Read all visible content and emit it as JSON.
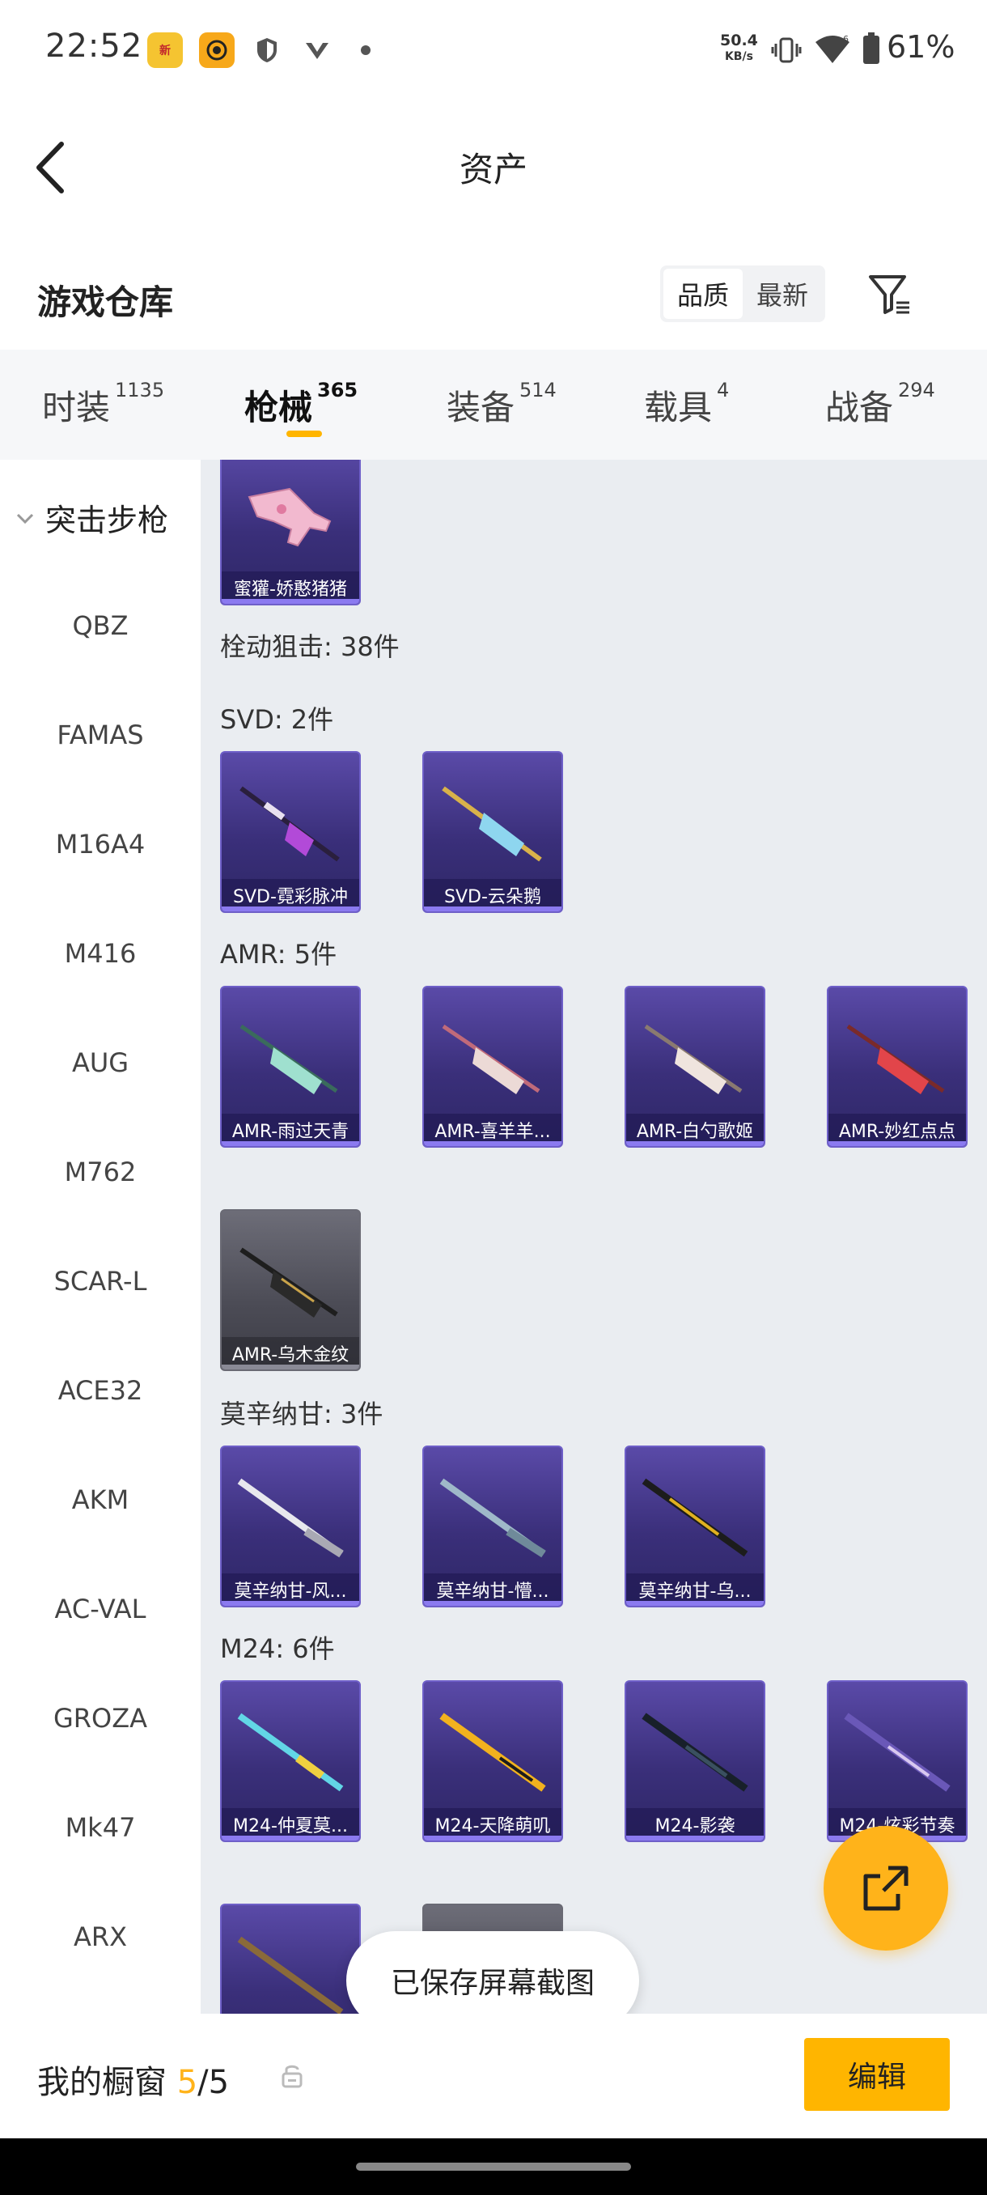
{
  "status_bar": {
    "time": "22:52",
    "net_speed_value": "50.4",
    "net_speed_unit": "KB/s",
    "battery": "61%",
    "app_icon_1_text": "新"
  },
  "header": {
    "title": "资产"
  },
  "section": {
    "title": "游戏仓库",
    "sort_options": [
      "品质",
      "最新"
    ]
  },
  "tabs": [
    {
      "label": "时装",
      "count": "1135"
    },
    {
      "label": "枪械",
      "count": "365"
    },
    {
      "label": "装备",
      "count": "514"
    },
    {
      "label": "载具",
      "count": "4"
    },
    {
      "label": "战备",
      "count": "294"
    }
  ],
  "sidebar": {
    "head": "突击步枪",
    "items": [
      "QBZ",
      "FAMAS",
      "M16A4",
      "M416",
      "AUG",
      "M762",
      "SCAR-L",
      "ACE32",
      "AKM",
      "AC-VAL",
      "GROZA",
      "Mk47",
      "ARX"
    ]
  },
  "content": {
    "top_card": "蜜獾-娇憨猪猪",
    "bolt_label": "栓动狙击: 38件",
    "groups": [
      {
        "label": "SVD: 2件",
        "items": [
          "SVD-霓彩脉冲",
          "SVD-云朵鹅"
        ]
      },
      {
        "label": "AMR: 5件",
        "items": [
          "AMR-雨过天青",
          "AMR-喜羊羊...",
          "AMR-白勺歌姬",
          "AMR-妙红点点",
          "AMR-乌木金纹"
        ]
      },
      {
        "label": "莫辛纳甘: 3件",
        "items": [
          "莫辛纳甘-风...",
          "莫辛纳甘-懵...",
          "莫辛纳甘-乌..."
        ]
      },
      {
        "label": "M24: 6件",
        "items": [
          "M24-仲夏莫...",
          "M24-天降萌叽",
          "M24-影袭",
          "M24-炫彩节奏"
        ]
      }
    ]
  },
  "toast": "已保存屏幕截图",
  "bottom": {
    "showcase_label": "我的橱窗",
    "current": "5",
    "total": "/5",
    "edit_label": "编辑"
  }
}
